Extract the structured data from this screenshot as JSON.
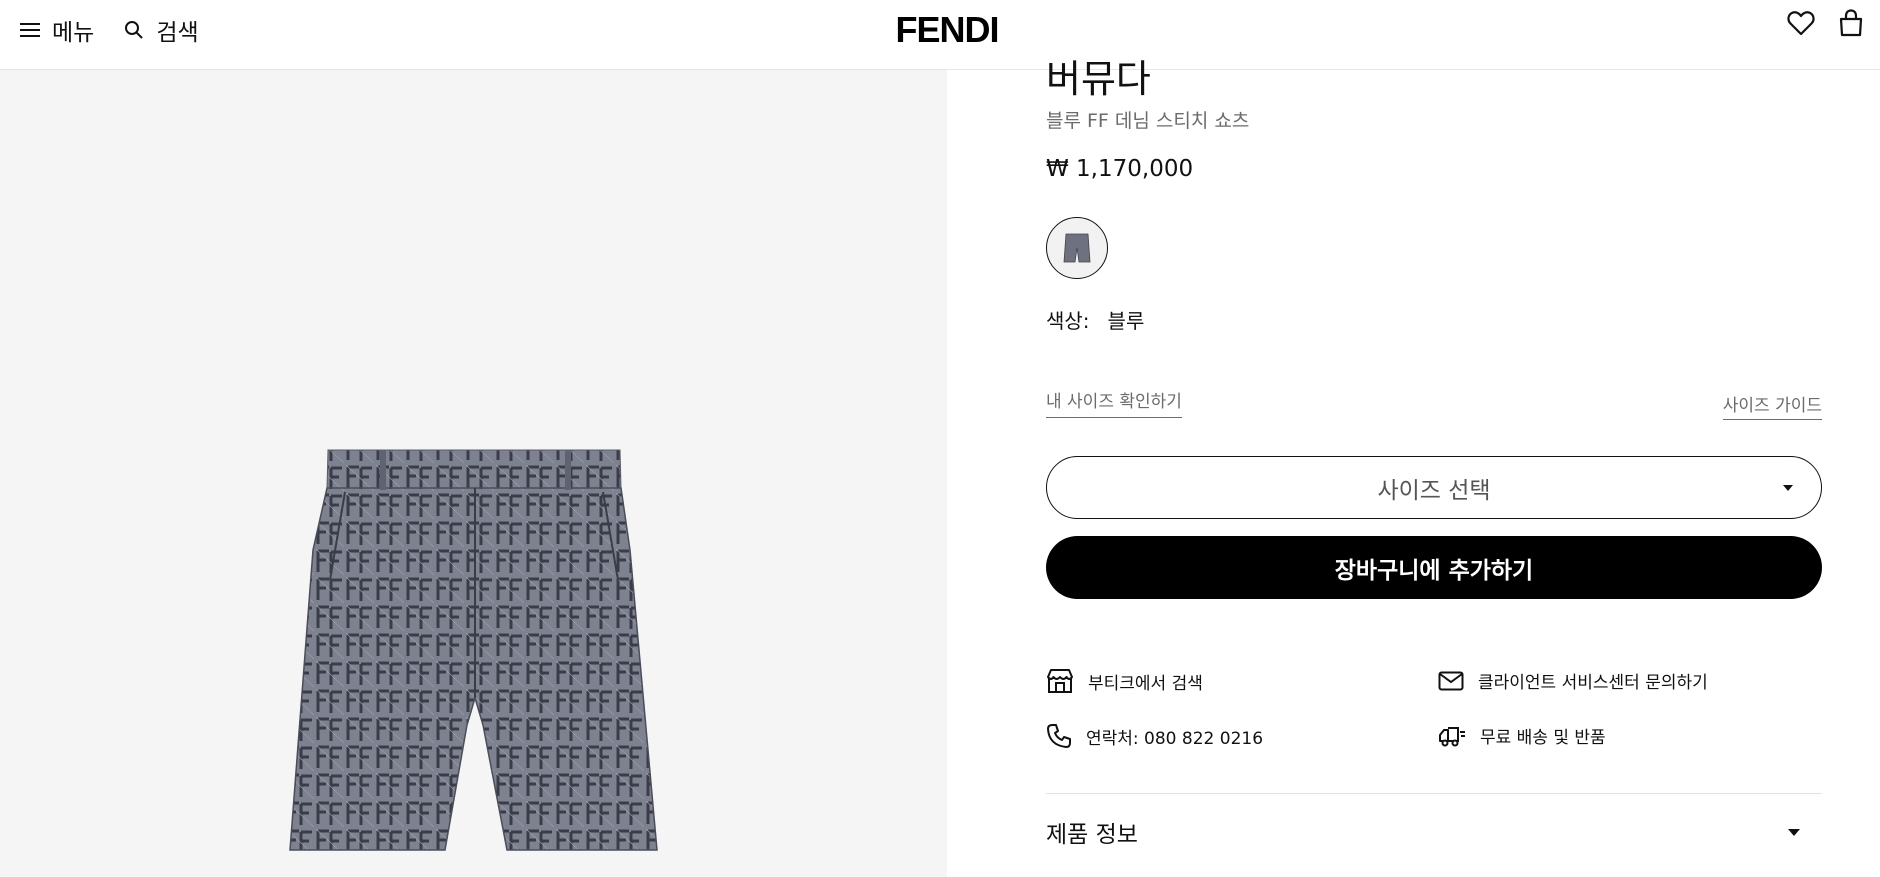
{
  "header": {
    "menu_label": "메뉴",
    "search_label": "검색",
    "logo": "FENDI"
  },
  "product": {
    "name": "버뮤다",
    "subtitle": "블루 FF 데님 스티치 쇼츠",
    "price": "₩ 1,170,000",
    "color_label": "색상:",
    "color_value": "블루",
    "size_check_label": "내 사이즈 확인하기",
    "size_guide_label": "사이즈 가이드",
    "size_select_label": "사이즈 선택",
    "add_to_cart_label": "장바구니에 추가하기"
  },
  "services": [
    {
      "icon": "store-icon",
      "label": "부티크에서 검색"
    },
    {
      "icon": "mail-icon",
      "label": "클라이언트 서비스센터 문의하기"
    },
    {
      "icon": "phone-icon",
      "label": "연락처: 080 822 0216"
    },
    {
      "icon": "truck-icon",
      "label": "무료 배송 및 반품"
    }
  ],
  "accordion": {
    "product_info_label": "제품 정보"
  },
  "colors": {
    "brand_black": "#000000",
    "image_bg": "#f5f5f6",
    "muted_text": "#6b6b6b"
  }
}
